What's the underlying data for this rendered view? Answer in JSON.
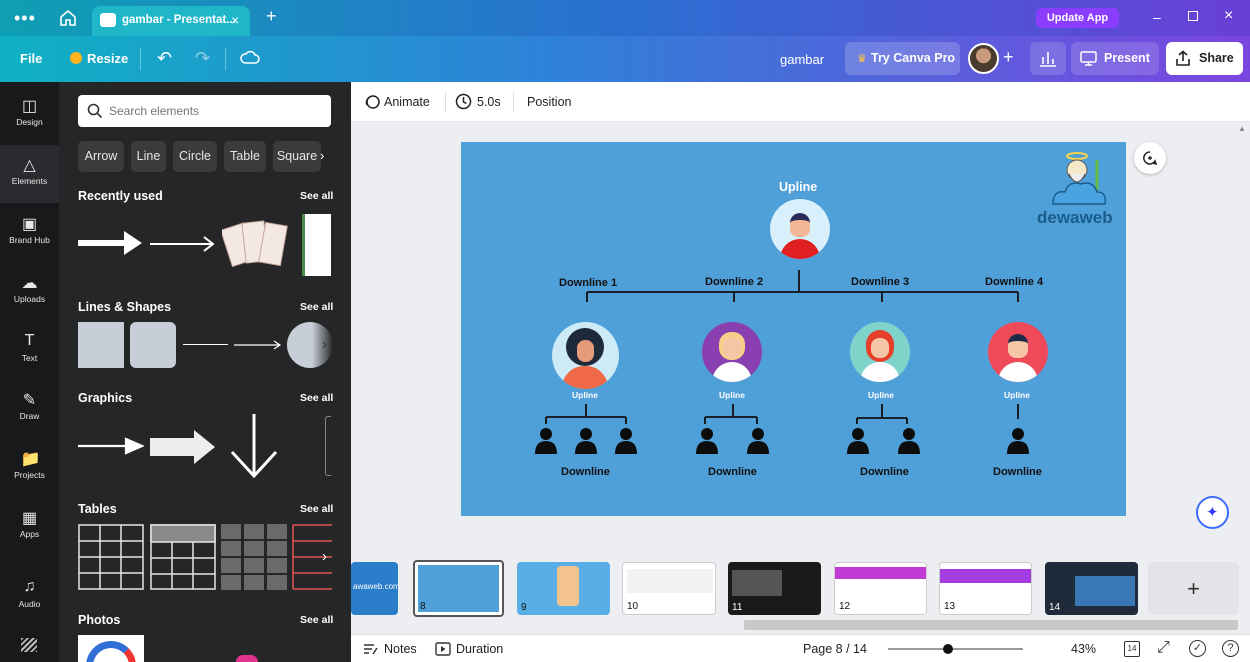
{
  "titlebar": {
    "tab_title": "gambar - Presentat...",
    "update_label": "Update App"
  },
  "toolbar": {
    "file_label": "File",
    "resize_label": "Resize",
    "doc_name": "gambar",
    "try_pro_label": "Try Canva Pro",
    "present_label": "Present",
    "share_label": "Share"
  },
  "rail": {
    "items": [
      {
        "label": "Design",
        "icon": "layout-icon"
      },
      {
        "label": "Elements",
        "icon": "shapes-icon"
      },
      {
        "label": "Brand Hub",
        "icon": "brand-icon"
      },
      {
        "label": "Uploads",
        "icon": "cloud-upload-icon"
      },
      {
        "label": "Text",
        "icon": "text-icon"
      },
      {
        "label": "Draw",
        "icon": "pen-icon"
      },
      {
        "label": "Projects",
        "icon": "folder-icon"
      },
      {
        "label": "Apps",
        "icon": "grid-icon"
      },
      {
        "label": "Audio",
        "icon": "music-icon"
      }
    ]
  },
  "panel": {
    "search_placeholder": "Search elements",
    "chips": [
      "Arrow",
      "Line",
      "Circle",
      "Table",
      "Square"
    ],
    "sections": {
      "recent": "Recently used",
      "lines": "Lines & Shapes",
      "graphics": "Graphics",
      "tables": "Tables",
      "photos": "Photos"
    },
    "see_all": "See all"
  },
  "context": {
    "animate_label": "Animate",
    "duration_label": "5.0s",
    "position_label": "Position"
  },
  "slide": {
    "top_label": "Upline",
    "downline_labels": [
      "Downline 1",
      "Downline 2",
      "Downline 3",
      "Downline 4"
    ],
    "sub_upline": "Upline",
    "bottom_label": "Downline",
    "logo_text": "dewaweb"
  },
  "strip": {
    "pages": [
      "8",
      "9",
      "10",
      "11",
      "12",
      "13",
      "14"
    ],
    "first_thumb_text": "awaweb.com"
  },
  "bottombar": {
    "notes_label": "Notes",
    "duration_label": "Duration",
    "page_label": "Page 8 / 14",
    "zoom_label": "43%",
    "page_count": "14"
  },
  "colors": {
    "slide_bg": "#4f9fd9",
    "panel_bg": "#252627",
    "accent_purple": "#8b3dff"
  }
}
